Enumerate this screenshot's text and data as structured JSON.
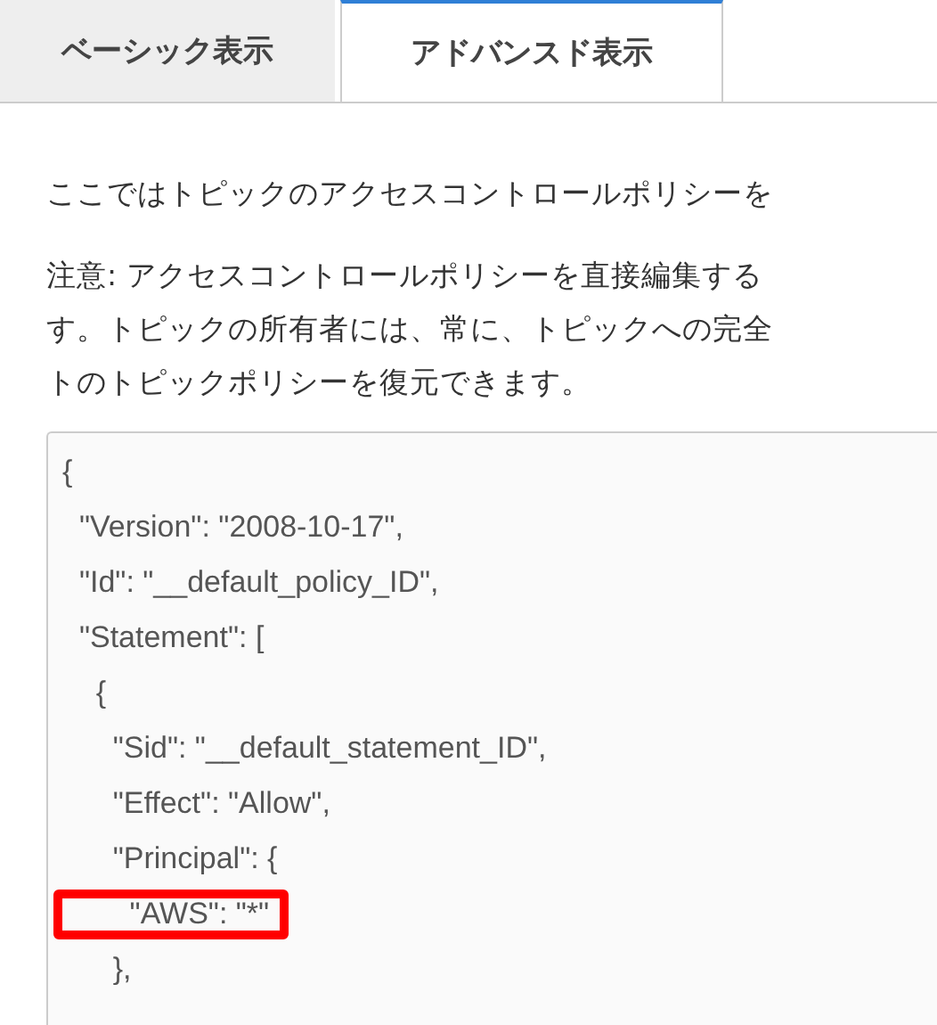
{
  "tabs": [
    {
      "label": "ベーシック表示",
      "selected": false
    },
    {
      "label": "アドバンスド表示",
      "selected": true
    }
  ],
  "intro": "ここではトピックのアクセスコントロールポリシーを",
  "note_lines": [
    "注意: アクセスコントロールポリシーを直接編集する",
    "す。トピックの所有者には、常に、トピックへの完全",
    "トのトピックポリシーを復元できます。"
  ],
  "policy_editor": {
    "lines": [
      {
        "text": "{",
        "highlighted": false
      },
      {
        "text": "  \"Version\": \"2008-10-17\",",
        "highlighted": false
      },
      {
        "text": "  \"Id\": \"__default_policy_ID\",",
        "highlighted": false
      },
      {
        "text": "  \"Statement\": [",
        "highlighted": false
      },
      {
        "text": "    {",
        "highlighted": false
      },
      {
        "text": "      \"Sid\": \"__default_statement_ID\",",
        "highlighted": false
      },
      {
        "text": "      \"Effect\": \"Allow\",",
        "highlighted": false
      },
      {
        "text": "      \"Principal\": {",
        "highlighted": false
      },
      {
        "text": "        \"AWS\": \"*\"",
        "highlighted": true
      },
      {
        "text": "      },",
        "highlighted": false
      }
    ]
  }
}
